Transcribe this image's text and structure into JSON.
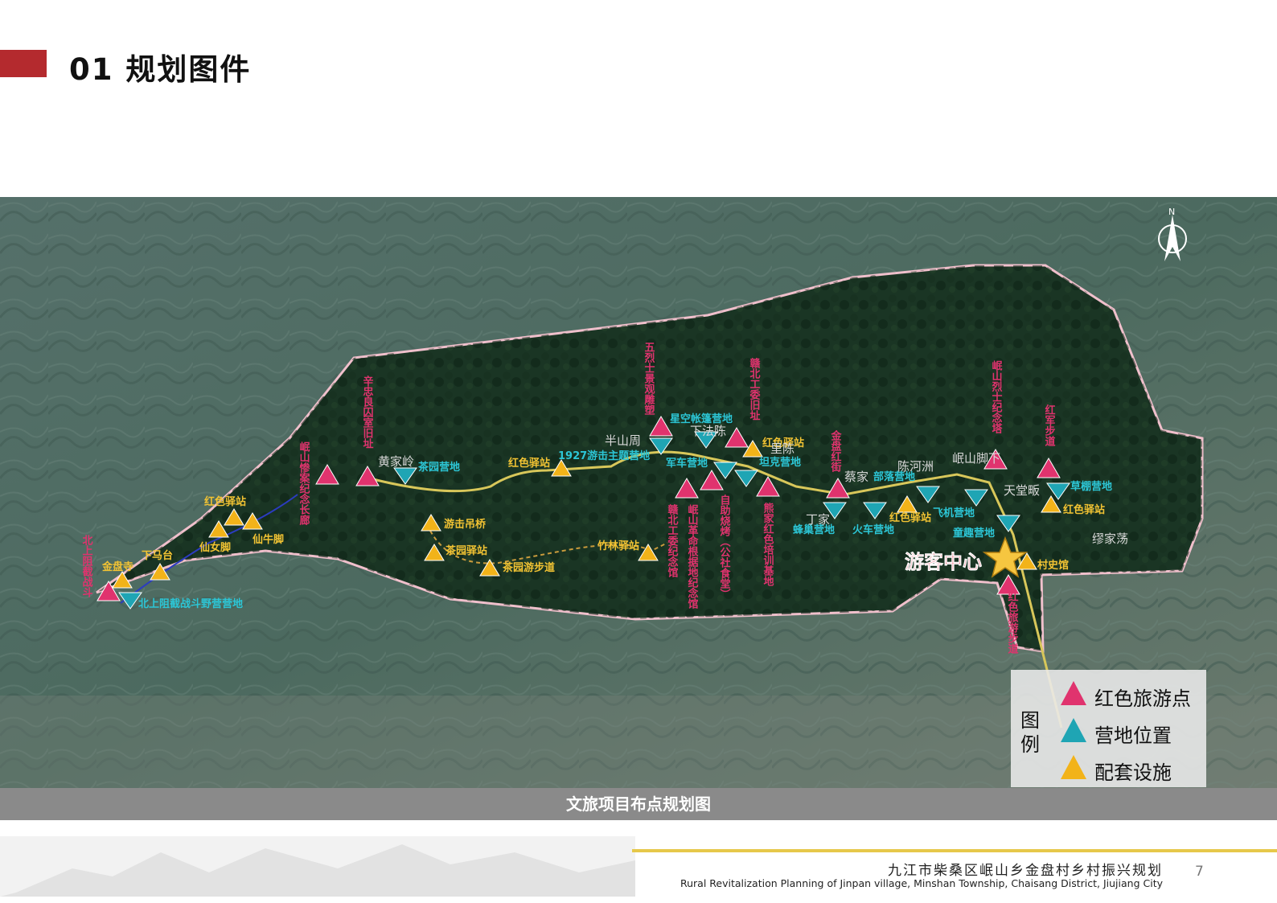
{
  "header": {
    "title": "01  规划图件"
  },
  "map": {
    "north": "N",
    "visitor_center": "游客中心",
    "labels": {
      "red": [
        "北上阻截战斗",
        "岷山惨案纪念长廊",
        "辛忠良囚室旧址",
        "五烈士景观雕塑",
        "赣北工委旧址",
        "赣北工委纪念馆",
        "岷山革命根据地纪念馆",
        "自助烧烤（公社食堂）",
        "熊家红色培训基地",
        "金盘红街",
        "岷山烈士纪念塔",
        "红军步道",
        "红色旅游步道"
      ],
      "teal": [
        "茶园营地",
        "1927游击主题营地",
        "星空帐篷营地",
        "军车营地",
        "坦克营地",
        "蜂巢营地",
        "部落营地",
        "火车营地",
        "飞机营地",
        "草棚营地",
        "童趣营地",
        "北上阻截战斗野营营地"
      ],
      "yellow": [
        "红色驿站",
        "仙女脚",
        "仙牛脚",
        "下马台",
        "金盘寺",
        "游击吊桥",
        "茶园驿站",
        "茶园游步道",
        "竹林驿站",
        "红色驿站",
        "红色驿站",
        "红色驿站",
        "红色驿站",
        "村史馆"
      ],
      "places": [
        "黄家岭",
        "半山周",
        "下法陈",
        "里陈",
        "蔡家",
        "丁家",
        "陈河洲",
        "岷山脚下",
        "天堂畈",
        "缪家荡"
      ]
    }
  },
  "caption": "文旅项目布点规划图",
  "legend": {
    "title": "图例",
    "items": [
      {
        "label": "红色旅游点",
        "color": "#e0336e"
      },
      {
        "label": "营地位置",
        "color": "#1fa5b4"
      },
      {
        "label": "配套设施",
        "color": "#f2b319"
      }
    ]
  },
  "footer": {
    "title_cn": "九江市柴桑区岷山乡金盘村乡村振兴规划",
    "title_en": "Rural Revitalization Planning of Jinpan village, Minshan Township, Chaisang District, Jiujiang City",
    "page": "7"
  },
  "colors": {
    "accent": "#b42a2e",
    "caption_bg": "#8a8a8a",
    "footer_line": "#e6c84a"
  }
}
